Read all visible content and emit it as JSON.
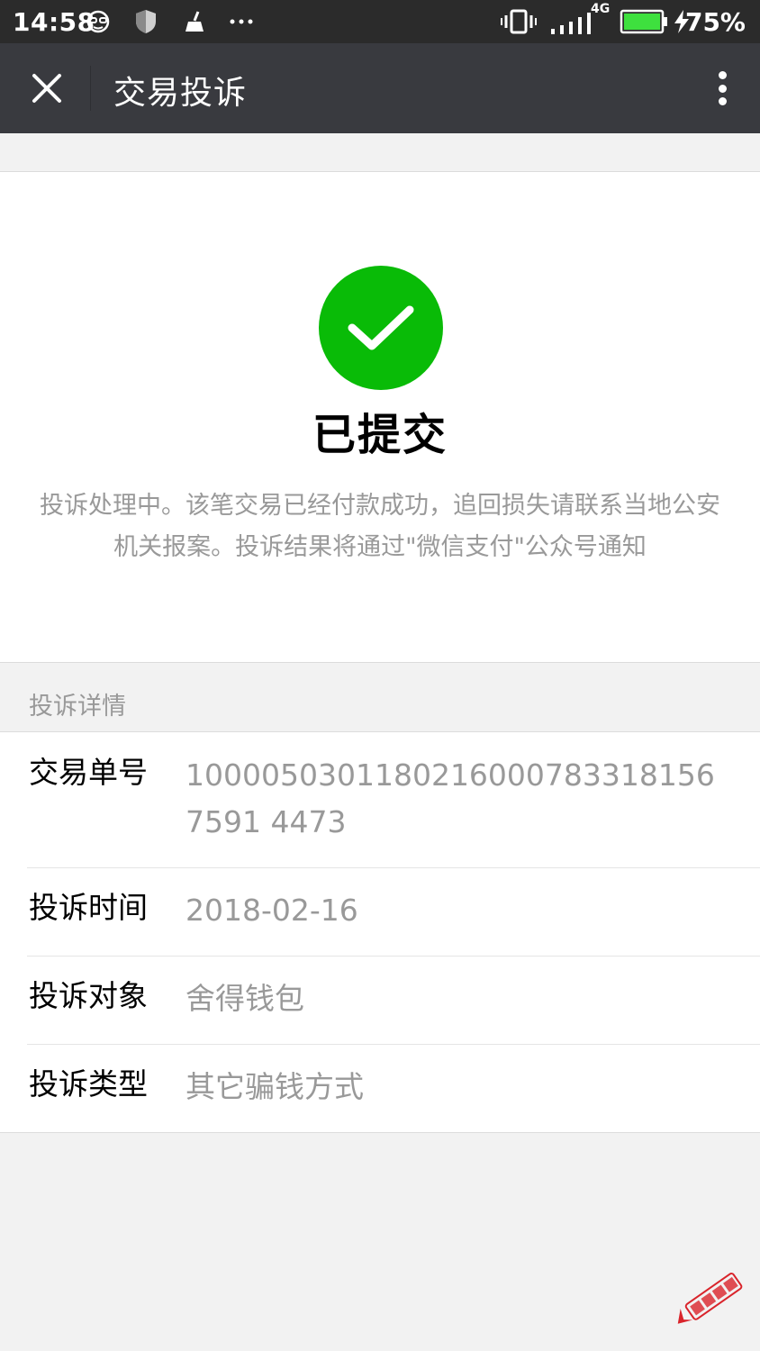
{
  "status_bar": {
    "time": "14:58",
    "network": "4G",
    "battery_percent": "75%",
    "icons": [
      "glasses-icon",
      "shield-icon",
      "broom-icon",
      "more-dots-icon",
      "vibrate-icon",
      "signal-icon",
      "battery-icon",
      "charging-icon"
    ]
  },
  "header": {
    "title": "交易投诉",
    "close_icon": "close-icon",
    "more_icon": "more-vertical-icon"
  },
  "result": {
    "icon": "check-circle-icon",
    "title": "已提交",
    "description": "投诉处理中。该笔交易已经付款成功，追回损失请联系当地公安机关报案。投诉结果将通过\"微信支付\"公众号通知"
  },
  "details": {
    "section_label": "投诉详情",
    "rows": [
      {
        "key": "交易单号",
        "value": "10000503011802160007833181567591 4473"
      },
      {
        "key": "投诉时间",
        "value": "2018-02-16"
      },
      {
        "key": "投诉对象",
        "value": "舍得钱包"
      },
      {
        "key": "投诉类型",
        "value": "其它骗钱方式"
      }
    ]
  },
  "colors": {
    "success_green": "#09bb07",
    "header_bg": "#393a3f",
    "status_bg": "#2b2b2b",
    "battery_green": "#3ee03e"
  }
}
